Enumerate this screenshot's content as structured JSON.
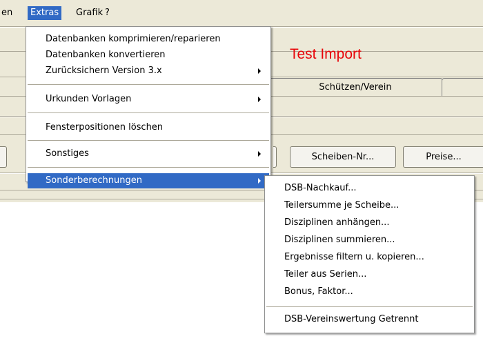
{
  "menubar": {
    "items": [
      {
        "label": "en"
      },
      {
        "label": "Extras",
        "active": true
      },
      {
        "label": "Grafik"
      },
      {
        "label": "?"
      }
    ]
  },
  "app": {
    "title": "Test Import",
    "tab_label": "Schützen/Verein",
    "buttons": {
      "scheiben": "Scheiben-Nr...",
      "preise": "Preise..."
    }
  },
  "extras_menu": {
    "items": [
      {
        "label": "Datenbanken komprimieren/reparieren",
        "submenu": false
      },
      {
        "label": "Datenbanken konvertieren",
        "submenu": false
      },
      {
        "label": "Zurücksichern Version 3.x",
        "submenu": true
      },
      {
        "label": "Urkunden Vorlagen",
        "submenu": true
      },
      {
        "label": "Fensterpositionen löschen",
        "submenu": false
      },
      {
        "label": "Sonstiges",
        "submenu": true
      },
      {
        "label": "Sonderberechnungen",
        "submenu": true,
        "highlighted": true
      }
    ]
  },
  "sonder_menu": {
    "items": [
      {
        "label": "DSB-Nachkauf..."
      },
      {
        "label": "Teilersumme je Scheibe..."
      },
      {
        "label": "Disziplinen anhängen..."
      },
      {
        "label": "Disziplinen summieren..."
      },
      {
        "label": "Ergebnisse filtern u. kopieren..."
      },
      {
        "label": "Teiler aus Serien..."
      },
      {
        "label": "Bonus, Faktor..."
      },
      {
        "label": "DSB-Vereinswertung Getrennt"
      }
    ]
  },
  "colors": {
    "title": "#e8060a",
    "highlight": "#316ac5",
    "chrome": "#ece9d8"
  }
}
